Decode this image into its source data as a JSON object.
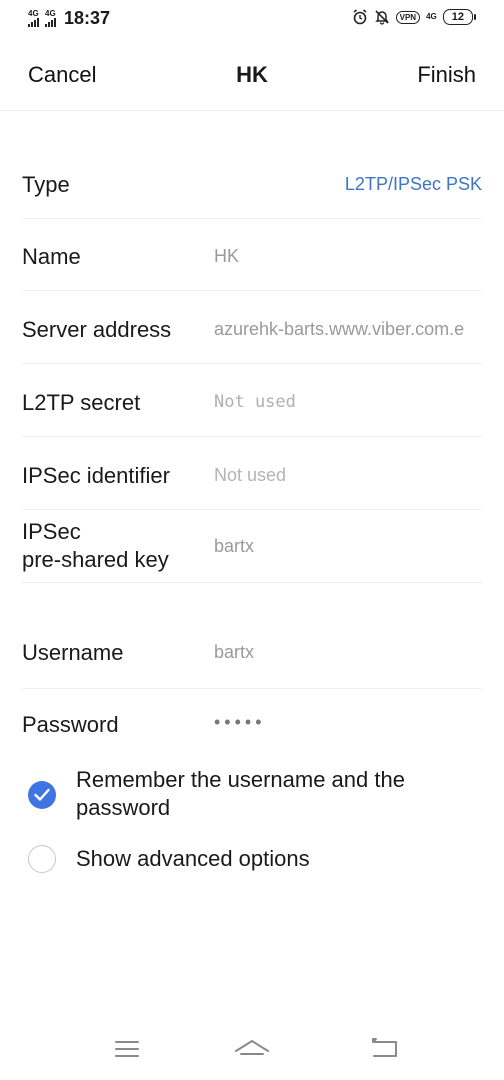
{
  "status_bar": {
    "network_1": "4G",
    "network_2": "4G",
    "time": "18:37",
    "vpn": "VPN",
    "network_4g": "4G",
    "battery": "12",
    "icons": [
      "alarm-icon",
      "bell-off-icon",
      "vpn-icon",
      "data-4g-icon",
      "battery-icon"
    ]
  },
  "header": {
    "cancel": "Cancel",
    "title": "HK",
    "finish": "Finish"
  },
  "form": {
    "type_label": "Type",
    "type_value": "L2TP/IPSec PSK",
    "name_label": "Name",
    "name_value": "HK",
    "server_label": "Server address",
    "server_value": "azurehk-barts.www.viber.com.e",
    "l2tp_label": "L2TP secret",
    "l2tp_placeholder": "Not used",
    "ipsec_id_label": "IPSec identifier",
    "ipsec_id_placeholder": "Not used",
    "ipsec_key_label_1": "IPSec",
    "ipsec_key_label_2": "pre-shared key",
    "ipsec_key_value": "bartx",
    "username_label": "Username",
    "username_value": "bartx",
    "password_label": "Password",
    "password_value": "•••••"
  },
  "options": {
    "remember_label_1": "Remember the username and the",
    "remember_label_2": "password",
    "remember_checked": true,
    "advanced_label": "Show advanced options",
    "advanced_checked": false
  },
  "colors": {
    "accent": "#3f75e3",
    "link": "#3f75c2",
    "muted_text": "#9a9a9a",
    "divider": "#eeeeee"
  },
  "navbar": {
    "icons": [
      "menu-icon",
      "home-icon",
      "back-icon"
    ]
  }
}
